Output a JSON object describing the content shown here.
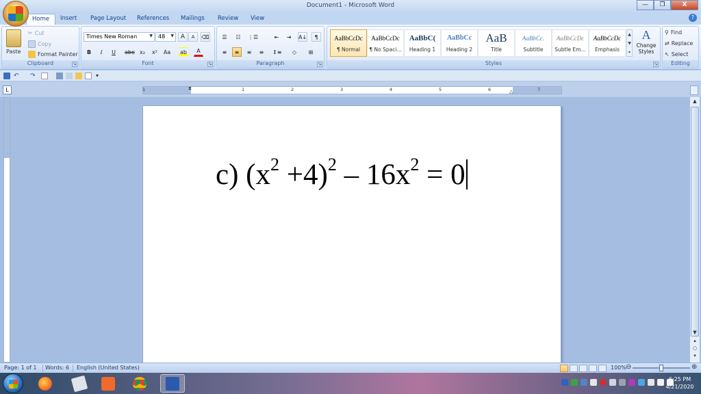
{
  "window": {
    "title": "Document1 - Microsoft Word",
    "minimize": "—",
    "restore": "❐",
    "close": "X"
  },
  "tabs": [
    {
      "label": "Home",
      "active": true
    },
    {
      "label": "Insert"
    },
    {
      "label": "Page Layout"
    },
    {
      "label": "References"
    },
    {
      "label": "Mailings"
    },
    {
      "label": "Review"
    },
    {
      "label": "View"
    }
  ],
  "clipboard": {
    "label": "Clipboard",
    "paste": "Paste",
    "cut": "Cut",
    "copy": "Copy",
    "format_painter": "Format Painter"
  },
  "font": {
    "label": "Font",
    "family": "Times New Roman",
    "size": "48",
    "grow": "A",
    "shrink": "A",
    "bold": "B",
    "italic": "I",
    "underline": "U",
    "strike": "abe",
    "subscript": "x₂",
    "superscript": "x²",
    "case": "Aa",
    "font_color": "A"
  },
  "paragraph": {
    "label": "Paragraph",
    "pilcrow": "¶",
    "sort": "A↓"
  },
  "styles": {
    "label": "Styles",
    "items": [
      {
        "sample": "AaBbCcDc",
        "name": "¶ Normal",
        "selected": true
      },
      {
        "sample": "AaBbCcDc",
        "name": "¶ No Spaci..."
      },
      {
        "sample": "AaBbC(",
        "name": "Heading 1"
      },
      {
        "sample": "AaBbCc",
        "name": "Heading 2"
      },
      {
        "sample": "AaB",
        "name": "Title"
      },
      {
        "sample": "AaBbCc.",
        "name": "Subtitle"
      },
      {
        "sample": "AaBbCcDc",
        "name": "Subtle Em..."
      },
      {
        "sample": "AaBbCcDc",
        "name": "Emphasis"
      }
    ],
    "change_styles": "Change Styles"
  },
  "editing": {
    "label": "Editing",
    "find": "Find",
    "replace": "Replace",
    "select": "Select"
  },
  "ruler": {
    "corner": "L",
    "numbers": [
      "1",
      "1",
      "2",
      "3",
      "4",
      "5",
      "6",
      "7"
    ]
  },
  "document": {
    "prefix": "c) (x",
    "mid1": " +4)",
    "mid2": " – 16x",
    "suffix": " = 0",
    "sup": "2"
  },
  "status": {
    "page": "Page: 1 of 1",
    "words": "Words: 6",
    "language": "English (United States)",
    "zoom": "100%",
    "zoom_level": 0.5
  },
  "taskbar": {
    "time": "6:25 PM",
    "date": "4/21/2020"
  },
  "colors": {
    "accent": "#15428b",
    "ribbon": "#dbe7f7",
    "workspace": "#a5bde0"
  }
}
